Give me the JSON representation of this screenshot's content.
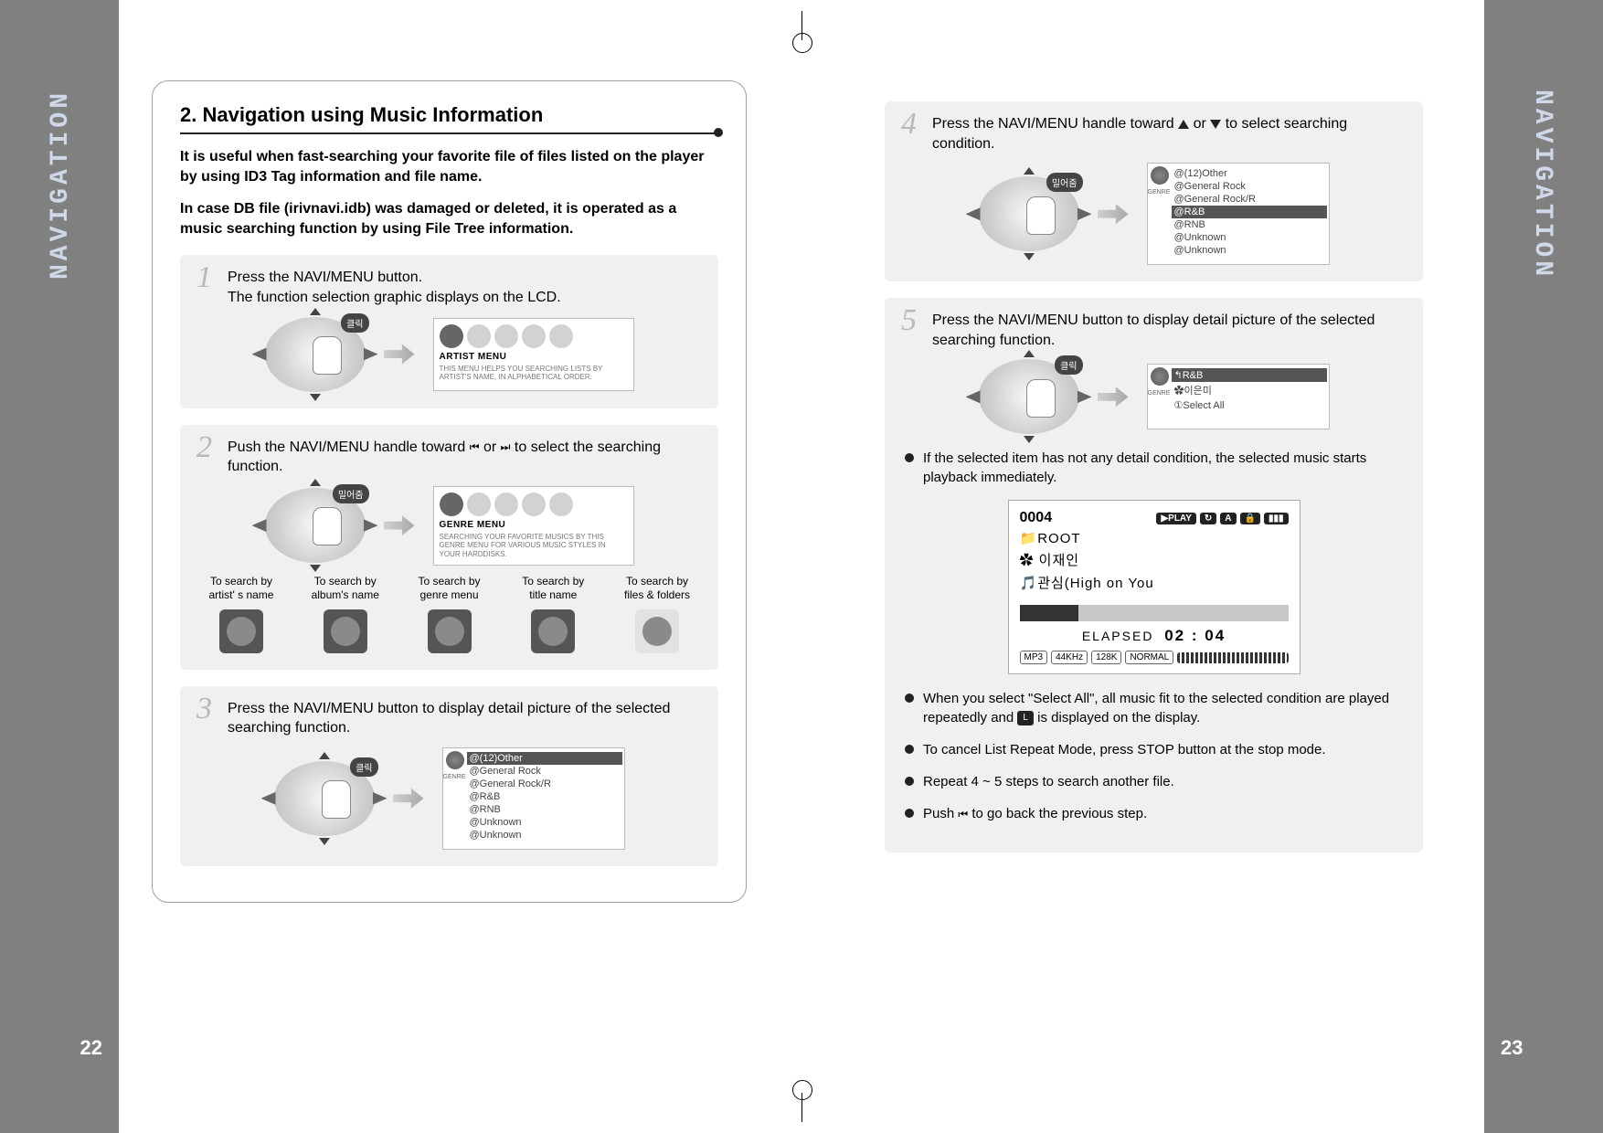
{
  "gutter": {
    "label": "NAVIGATION",
    "page_left": "22",
    "page_right": "23"
  },
  "left": {
    "heading": "2. Navigation using Music Information",
    "intro1": "It is useful when fast-searching your favorite file of files listed on the player by using ID3 Tag information and file name.",
    "intro2": "In case DB file (irivnavi.idb) was damaged or deleted, it is operated as a music searching function by using File Tree information.",
    "step1": {
      "num": "1",
      "text": "Press the NAVI/MENU button.\nThe function selection graphic displays on the LCD.",
      "badge": "클릭",
      "lcd_title": "ARTIST MENU",
      "lcd_desc": "THIS MENU HELPS YOU SEARCHING LISTS BY ARTIST'S NAME, IN ALPHABETICAL ORDER."
    },
    "step2": {
      "num": "2",
      "text_a": "Push the NAVI/MENU handle toward ",
      "text_b": " or ",
      "text_c": " to select the searching function.",
      "badge": "밀어줌",
      "lcd_title": "GENRE MENU",
      "lcd_desc": "SEARCHING YOUR FAVORITE MUSICS BY THIS GENRE MENU FOR VARIOUS MUSIC STYLES IN YOUR HARDDISKS.",
      "cols": [
        "To search by artist' s name",
        "To search by album's name",
        "To search by genre menu",
        "To search by title name",
        "To search by files & folders"
      ]
    },
    "step3": {
      "num": "3",
      "text": "Press the NAVI/MENU button to display detail picture of the selected searching function.",
      "badge": "클릭",
      "genre_label": "GENRE",
      "rows": [
        "@(12)Other",
        "@General Rock",
        "@General Rock/R",
        "@R&B",
        "@RNB",
        "@Unknown",
        "@Unknown"
      ],
      "sel_index": 0
    }
  },
  "right": {
    "step4": {
      "num": "4",
      "text_a": "Press the NAVI/MENU handle toward ",
      "text_b": " or ",
      "text_c": " to select searching condition.",
      "badge": "밀어줌",
      "genre_label": "GENRE",
      "rows": [
        "@(12)Other",
        "@General Rock",
        "@General Rock/R",
        "@R&B",
        "@RNB",
        "@Unknown",
        "@Unknown"
      ],
      "sel_index": 3
    },
    "step5": {
      "num": "5",
      "text": "Press the NAVI/MENU button to display detail picture of the selected searching function.",
      "badge": "클릭",
      "genre_label": "GENRE",
      "rows": [
        "↰R&B",
        "✿이은미",
        "①Select All"
      ],
      "sel_index": 0
    },
    "bullets": {
      "b1": "If the selected item has not any detail condition, the selected music starts playback immediately.",
      "b2_a": "When you select \"Select All\", all music fit to the selected condition are played repeatedly and ",
      "b2_b": " is displayed on the display.",
      "b2_pill": "L",
      "b3": "To cancel List Repeat Mode, press STOP button at the stop mode.",
      "b4": "Repeat 4 ~ 5 steps to search another file.",
      "b5_a": "Push ",
      "b5_b": " to go back the previous step."
    },
    "play": {
      "track_no": "0004",
      "tag_play": "▶PLAY",
      "folder": "ROOT",
      "artist": "이재인",
      "title": "관심(High on You",
      "elapsed_label": "ELAPSED",
      "elapsed_time": "02 : 04",
      "footer": [
        "MP3",
        "44KHz",
        "128K",
        "NORMAL"
      ]
    }
  }
}
